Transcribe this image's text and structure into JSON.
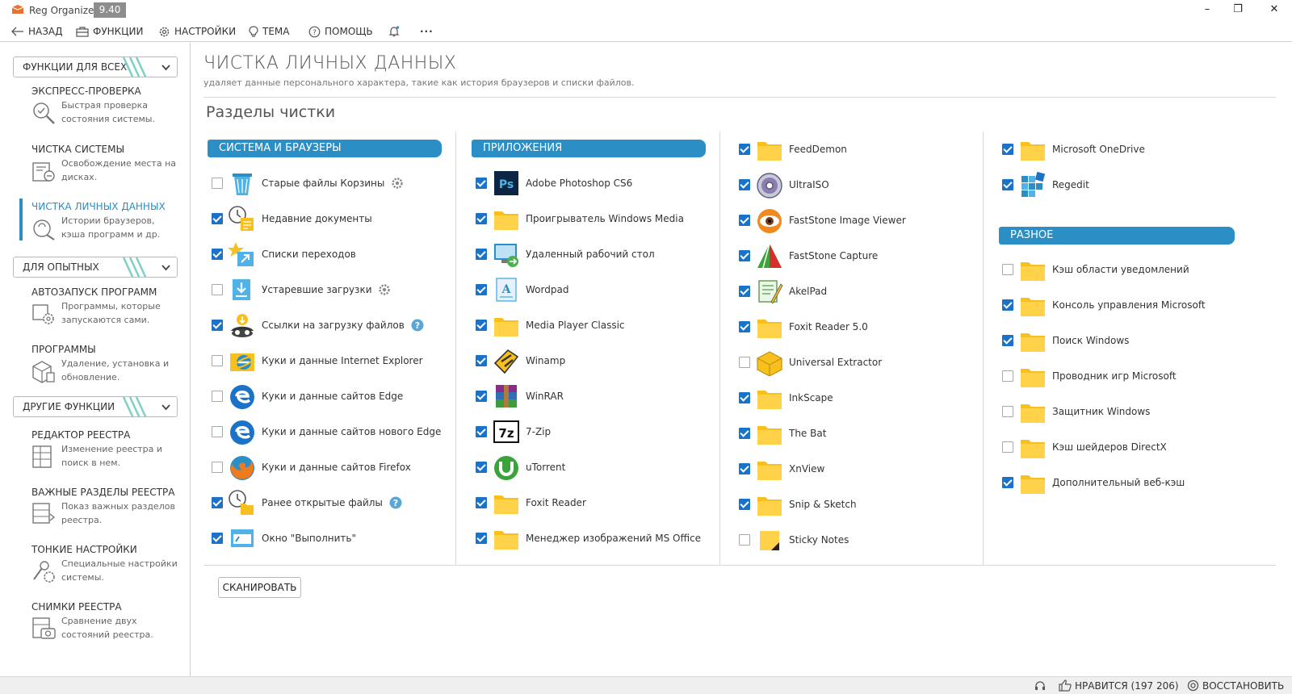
{
  "app": {
    "name": "Reg Organizer",
    "version": "9.40"
  },
  "window": {
    "minimize": "–",
    "maximize": "❐",
    "close": "✕"
  },
  "toolbar": {
    "back": "НАЗАД",
    "functions": "ФУНКЦИИ",
    "settings": "НАСТРОЙКИ",
    "theme": "ТЕМА",
    "help": "ПОМОЩЬ",
    "more": "···"
  },
  "sidebar": {
    "groups": [
      "ФУНКЦИИ ДЛЯ ВСЕХ",
      "ДЛЯ ОПЫТНЫХ",
      "ДРУГИЕ ФУНКЦИИ"
    ],
    "items": [
      {
        "title": "ЭКСПРЕСС-ПРОВЕРКА",
        "desc": "Быстрая проверка состояния системы."
      },
      {
        "title": "ЧИСТКА СИСТЕМЫ",
        "desc": "Освобождение места на дисках."
      },
      {
        "title": "ЧИСТКА ЛИЧНЫХ ДАННЫХ",
        "desc": "Истории браузеров, кэша программ и др."
      },
      {
        "title": "АВТОЗАПУСК ПРОГРАММ",
        "desc": "Программы, которые запускаются сами."
      },
      {
        "title": "ПРОГРАММЫ",
        "desc": "Удаление, установка и обновление."
      },
      {
        "title": "РЕДАКТОР РЕЕСТРА",
        "desc": "Изменение реестра и поиск в нем."
      },
      {
        "title": "ВАЖНЫЕ РАЗДЕЛЫ РЕЕСТРА",
        "desc": "Показ важных разделов реестра."
      },
      {
        "title": "ТОНКИЕ НАСТРОЙКИ",
        "desc": "Специальные настройки системы."
      },
      {
        "title": "СНИМКИ РЕЕСТРА",
        "desc": "Сравнение двух состояний реестра."
      }
    ]
  },
  "main": {
    "title": "ЧИСТКА ЛИЧНЫХ ДАННЫХ",
    "subtitle": "удаляет данные персонального характера, такие как история браузеров и списки файлов.",
    "section_title": "Разделы чистки",
    "scan_button": "СКАНИРОВАТЬ"
  },
  "categories": [
    "СИСТЕМА И БРАУЗЕРЫ",
    "ПРИЛОЖЕНИЯ",
    "РАЗНОЕ"
  ],
  "columns": [
    [
      {
        "label": "Старые файлы Корзины",
        "checked": false,
        "icon": "recycle-bin",
        "extra": "gear"
      },
      {
        "label": "Недавние документы",
        "checked": true,
        "icon": "recent-docs"
      },
      {
        "label": "Списки переходов",
        "checked": true,
        "icon": "jump-list"
      },
      {
        "label": "Устаревшие загрузки",
        "checked": false,
        "icon": "downloads",
        "extra": "gear"
      },
      {
        "label": "Ссылки на загрузку файлов",
        "checked": true,
        "icon": "download-links",
        "extra": "help"
      },
      {
        "label": "Куки и данные Internet Explorer",
        "checked": false,
        "icon": "internet-explorer"
      },
      {
        "label": "Куки и данные сайтов Edge",
        "checked": false,
        "icon": "edge"
      },
      {
        "label": "Куки и данные сайтов нового Edge",
        "checked": false,
        "icon": "edge"
      },
      {
        "label": "Куки и данные сайтов Firefox",
        "checked": false,
        "icon": "firefox"
      },
      {
        "label": "Ранее открытые файлы",
        "checked": true,
        "icon": "opened-files",
        "extra": "help"
      },
      {
        "label": "Окно \"Выполнить\"",
        "checked": true,
        "icon": "run-dialog"
      }
    ],
    [
      {
        "label": "Adobe Photoshop CS6",
        "checked": true,
        "icon": "photoshop"
      },
      {
        "label": "Проигрыватель Windows Media",
        "checked": true,
        "icon": "folder"
      },
      {
        "label": "Удаленный рабочий стол",
        "checked": true,
        "icon": "remote-desktop"
      },
      {
        "label": "Wordpad",
        "checked": true,
        "icon": "wordpad"
      },
      {
        "label": "Media Player Classic",
        "checked": true,
        "icon": "folder"
      },
      {
        "label": "Winamp",
        "checked": true,
        "icon": "winamp"
      },
      {
        "label": "WinRAR",
        "checked": true,
        "icon": "winrar"
      },
      {
        "label": "7-Zip",
        "checked": true,
        "icon": "7zip"
      },
      {
        "label": "uTorrent",
        "checked": true,
        "icon": "utorrent"
      },
      {
        "label": "Foxit Reader",
        "checked": true,
        "icon": "folder"
      },
      {
        "label": "Менеджер изображений MS Office",
        "checked": true,
        "icon": "folder"
      }
    ],
    [
      {
        "label": "FeedDemon",
        "checked": true,
        "icon": "folder"
      },
      {
        "label": "UltraISO",
        "checked": true,
        "icon": "ultraiso"
      },
      {
        "label": "FastStone Image Viewer",
        "checked": true,
        "icon": "faststone-viewer"
      },
      {
        "label": "FastStone Capture",
        "checked": true,
        "icon": "faststone-capture"
      },
      {
        "label": "AkelPad",
        "checked": true,
        "icon": "akelpad"
      },
      {
        "label": "Foxit Reader 5.0",
        "checked": true,
        "icon": "folder"
      },
      {
        "label": "Universal Extractor",
        "checked": false,
        "icon": "universal-extractor"
      },
      {
        "label": "InkScape",
        "checked": true,
        "icon": "folder"
      },
      {
        "label": "The Bat",
        "checked": true,
        "icon": "folder"
      },
      {
        "label": "XnView",
        "checked": true,
        "icon": "folder"
      },
      {
        "label": "Snip & Sketch",
        "checked": true,
        "icon": "folder"
      },
      {
        "label": "Sticky Notes",
        "checked": false,
        "icon": "sticky-notes"
      }
    ],
    [
      {
        "label": "Microsoft OneDrive",
        "checked": true,
        "icon": "folder"
      },
      {
        "label": "Regedit",
        "checked": true,
        "icon": "regedit"
      }
    ],
    [
      {
        "label": "Кэш области уведомлений",
        "checked": false,
        "icon": "folder"
      },
      {
        "label": "Консоль управления Microsoft",
        "checked": true,
        "icon": "folder"
      },
      {
        "label": "Поиск Windows",
        "checked": true,
        "icon": "folder"
      },
      {
        "label": "Проводник игр Microsoft",
        "checked": false,
        "icon": "folder"
      },
      {
        "label": "Защитник Windows",
        "checked": false,
        "icon": "folder"
      },
      {
        "label": "Кэш шейдеров DirectX",
        "checked": false,
        "icon": "folder"
      },
      {
        "label": "Дополнительный веб-кэш",
        "checked": true,
        "icon": "folder"
      }
    ]
  ],
  "statusbar": {
    "like": "НРАВИТСЯ (197 206)",
    "restore": "ВОССТАНОВИТЬ"
  },
  "colors": {
    "accent": "#2b8ec4",
    "checkbox": "#1a73c8",
    "folder": "#f7c01e"
  }
}
